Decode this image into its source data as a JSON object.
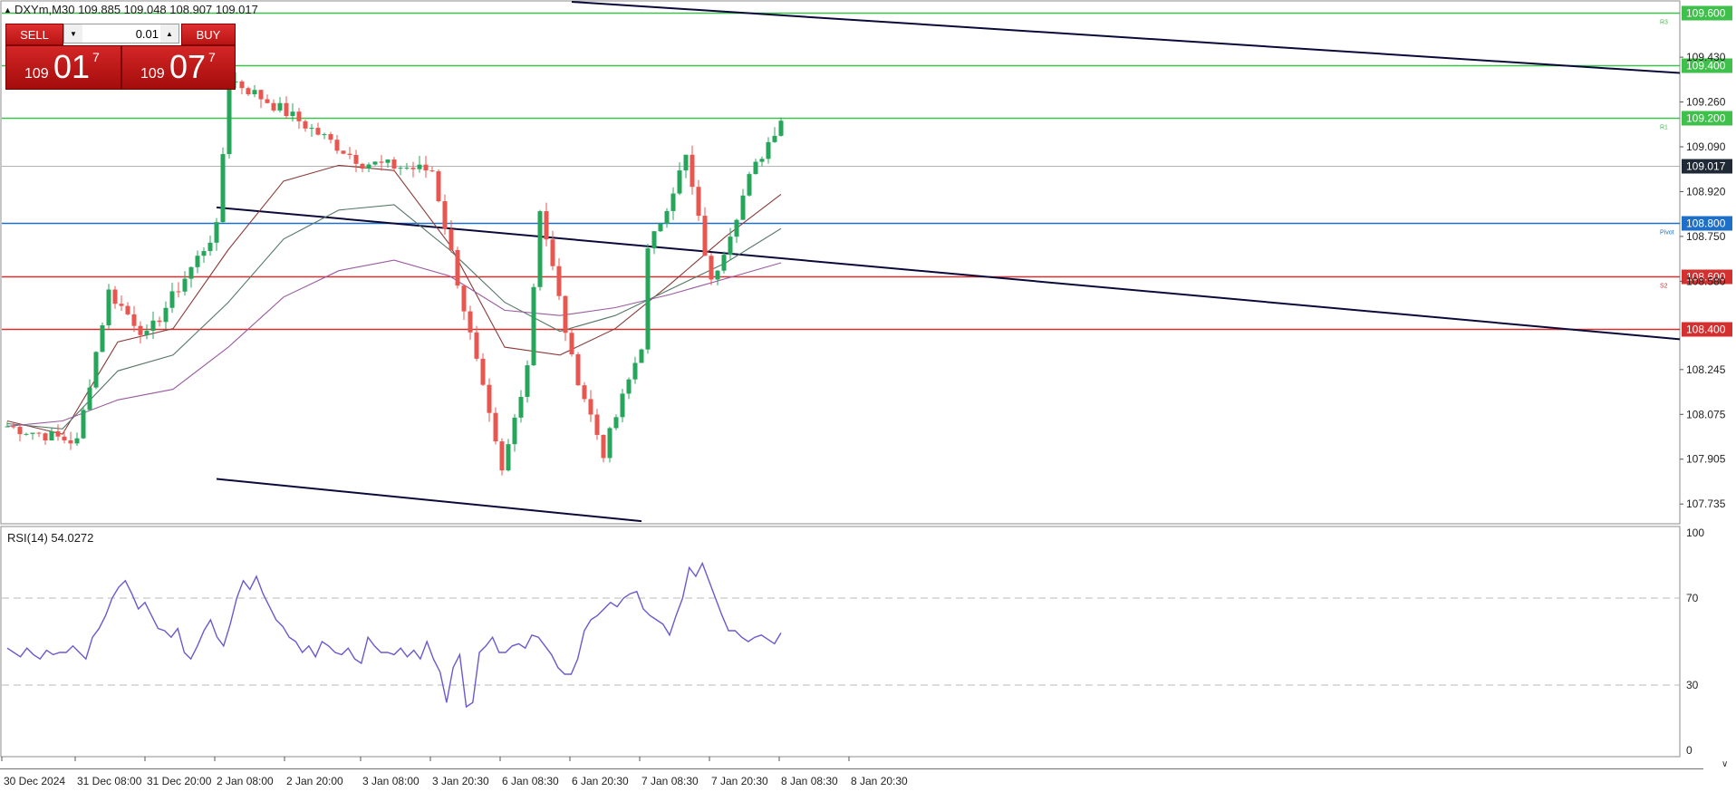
{
  "header": {
    "symbol_info": "DXYm,M30  109.885 109.048 108.907 109.017"
  },
  "trade_panel": {
    "sell_label": "SELL",
    "buy_label": "BUY",
    "lot_value": "0.01",
    "sell_price_prefix": "109",
    "sell_price_big": "01",
    "sell_price_sup": "7",
    "buy_price_prefix": "109",
    "buy_price_big": "07",
    "buy_price_sup": "7"
  },
  "chart_data": [
    {
      "type": "candlestick",
      "title": "",
      "ylim": [
        107.66,
        109.64
      ],
      "price_axis_ticks": [
        "109.430",
        "109.260",
        "109.090",
        "108.920",
        "108.750",
        "108.580",
        "108.245",
        "108.075",
        "107.905",
        "107.735"
      ],
      "time_axis_labels": [
        "30 Dec 2024",
        "31 Dec 08:00",
        "31 Dec 20:00",
        "2 Jan 08:00",
        "2 Jan 20:00",
        "3 Jan 08:00",
        "3 Jan 20:30",
        "6 Jan 08:30",
        "6 Jan 20:30",
        "7 Jan 08:30",
        "7 Jan 20:30",
        "8 Jan 08:30",
        "8 Jan 20:30"
      ],
      "current_price": "109.017",
      "bullish_color": "#26a65b",
      "bearish_color": "#e8574f",
      "key_points": [
        {
          "time": "30 Dec 2024",
          "price": 108.03
        },
        {
          "time": "31 Dec 08:00",
          "price": 107.97
        },
        {
          "time": "31 Dec 14:00",
          "price": 108.54
        },
        {
          "time": "31 Dec 20:00",
          "price": 108.37
        },
        {
          "time": "2 Jan 08:00",
          "price": 108.78
        },
        {
          "time": "2 Jan 12:00",
          "price": 109.35
        },
        {
          "time": "2 Jan 20:00",
          "price": 109.22
        },
        {
          "time": "3 Jan 08:00",
          "price": 109.03
        },
        {
          "time": "3 Jan 20:30",
          "price": 109.0
        },
        {
          "time": "6 Jan 02:00",
          "price": 108.86
        },
        {
          "time": "6 Jan 08:30",
          "price": 107.85
        },
        {
          "time": "6 Jan 14:00",
          "price": 108.27
        },
        {
          "time": "6 Jan 20:30",
          "price": 108.28
        },
        {
          "time": "7 Jan 04:00",
          "price": 107.93
        },
        {
          "time": "7 Jan 08:30",
          "price": 108.34
        },
        {
          "time": "7 Jan 14:00",
          "price": 108.63
        },
        {
          "time": "7 Jan 20:30",
          "price": 108.57
        },
        {
          "time": "8 Jan 04:00",
          "price": 109.05
        },
        {
          "time": "8 Jan 08:30",
          "price": 109.2
        },
        {
          "time": "8 Jan 16:00",
          "price": 108.97
        },
        {
          "time": "8 Jan 20:30",
          "price": 108.98
        },
        {
          "time": "8 Jan 23:00",
          "price": 109.017
        }
      ],
      "horizontal_levels": [
        {
          "label": "109.600",
          "price": 109.6,
          "color": "#3ec04a",
          "side_label": "R3"
        },
        {
          "label": "109.400",
          "price": 109.4,
          "color": "#3ec04a",
          "side_label": ""
        },
        {
          "label": "109.200",
          "price": 109.2,
          "color": "#3ec04a",
          "side_label": "R1"
        },
        {
          "label": "108.800",
          "price": 108.8,
          "color": "#1e6fc8",
          "side_label": "Pivot"
        },
        {
          "label": "108.600",
          "price": 108.6,
          "color": "#d43030",
          "side_label": "S2"
        },
        {
          "label": "108.400",
          "price": 108.4,
          "color": "#d43030",
          "side_label": ""
        }
      ],
      "trendlines": [
        {
          "from": {
            "time": "6 Jan 20:30",
            "price": 109.64
          },
          "to": {
            "time": "end",
            "price": 109.37
          }
        },
        {
          "from": {
            "time": "2 Jan 08:00",
            "price": 108.86
          },
          "to": {
            "time": "end",
            "price": 108.36
          }
        },
        {
          "from": {
            "time": "2 Jan 08:00",
            "price": 107.83
          },
          "to": {
            "time": "7 Jan 08:30",
            "price": 107.67
          }
        }
      ],
      "moving_averages": [
        {
          "color": "#8b3a3a",
          "key_points": [
            108.05,
            108.0,
            108.35,
            108.4,
            108.7,
            108.96,
            109.02,
            109.0,
            108.72,
            108.33,
            108.3,
            108.4,
            108.57,
            108.75,
            108.91
          ]
        },
        {
          "color": "#557766",
          "key_points": [
            108.04,
            108.02,
            108.24,
            108.3,
            108.5,
            108.74,
            108.85,
            108.87,
            108.7,
            108.5,
            108.39,
            108.45,
            108.55,
            108.65,
            108.78
          ]
        },
        {
          "color": "#9a5aa0",
          "key_points": [
            108.03,
            108.05,
            108.13,
            108.17,
            108.33,
            108.52,
            108.62,
            108.66,
            108.6,
            108.47,
            108.45,
            108.48,
            108.53,
            108.59,
            108.65
          ]
        }
      ]
    },
    {
      "type": "line",
      "title": "RSI(14) 54.0272",
      "ylim": [
        0,
        100
      ],
      "y_ticks": [
        "100",
        "70",
        "30",
        "0"
      ],
      "levels": [
        70,
        30
      ],
      "line_color": "#6a5acd",
      "values": [
        47,
        45,
        43,
        47,
        44,
        42,
        46,
        44,
        45,
        45,
        48,
        45,
        42,
        52,
        56,
        62,
        70,
        75,
        78,
        72,
        65,
        68,
        62,
        56,
        55,
        52,
        56,
        45,
        42,
        48,
        55,
        60,
        52,
        48,
        58,
        70,
        78,
        74,
        80,
        72,
        66,
        60,
        57,
        52,
        50,
        45,
        48,
        43,
        50,
        48,
        45,
        44,
        47,
        42,
        40,
        52,
        48,
        45,
        45,
        44,
        47,
        43,
        46,
        42,
        50,
        42,
        36,
        22,
        38,
        44,
        20,
        22,
        45,
        48,
        52,
        45,
        45,
        48,
        49,
        47,
        53,
        52,
        48,
        44,
        38,
        35,
        35,
        42,
        55,
        60,
        62,
        65,
        68,
        66,
        70,
        72,
        73,
        65,
        62,
        60,
        58,
        53,
        62,
        70,
        84,
        80,
        86,
        78,
        70,
        62,
        55,
        55,
        52,
        50,
        52,
        53,
        51,
        49,
        54
      ]
    }
  ]
}
